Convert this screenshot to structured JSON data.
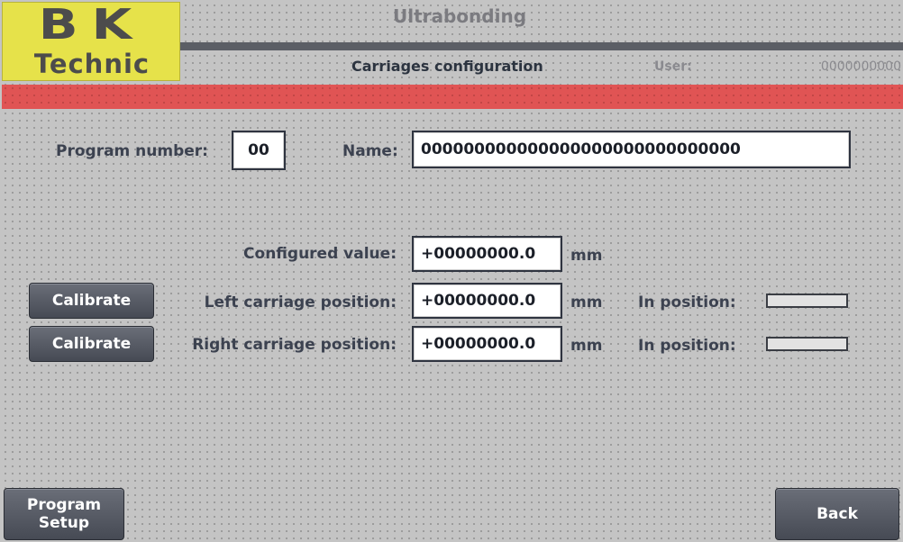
{
  "logo": {
    "line1": "BK",
    "line2": "Technic"
  },
  "header": {
    "app_title": "Ultrabonding",
    "page_title": "Carriages configuration",
    "user_label": "User:",
    "user_value": "0000000000"
  },
  "program": {
    "number_label": "Program number:",
    "number_value": "00",
    "name_label": "Name:",
    "name_value": "000000000000000000000000000000"
  },
  "configured": {
    "label": "Configured value:",
    "value": "+00000000.0",
    "unit": "mm"
  },
  "left_carriage": {
    "calibrate_label": "Calibrate",
    "label": "Left carriage position:",
    "value": "+00000000.0",
    "unit": "mm",
    "in_position_label": "In position:"
  },
  "right_carriage": {
    "calibrate_label": "Calibrate",
    "label": "Right carriage position:",
    "value": "+00000000.0",
    "unit": "mm",
    "in_position_label": "In position:"
  },
  "footer": {
    "program_setup_label_1": "Program",
    "program_setup_label_2": "Setup",
    "back_label": "Back"
  },
  "colors": {
    "background": "#c4c4c4",
    "logo_yellow": "#e6e24a",
    "alarm_red": "#e05454",
    "button_gray": "#575b65",
    "header_bar": "#5b5e65"
  }
}
